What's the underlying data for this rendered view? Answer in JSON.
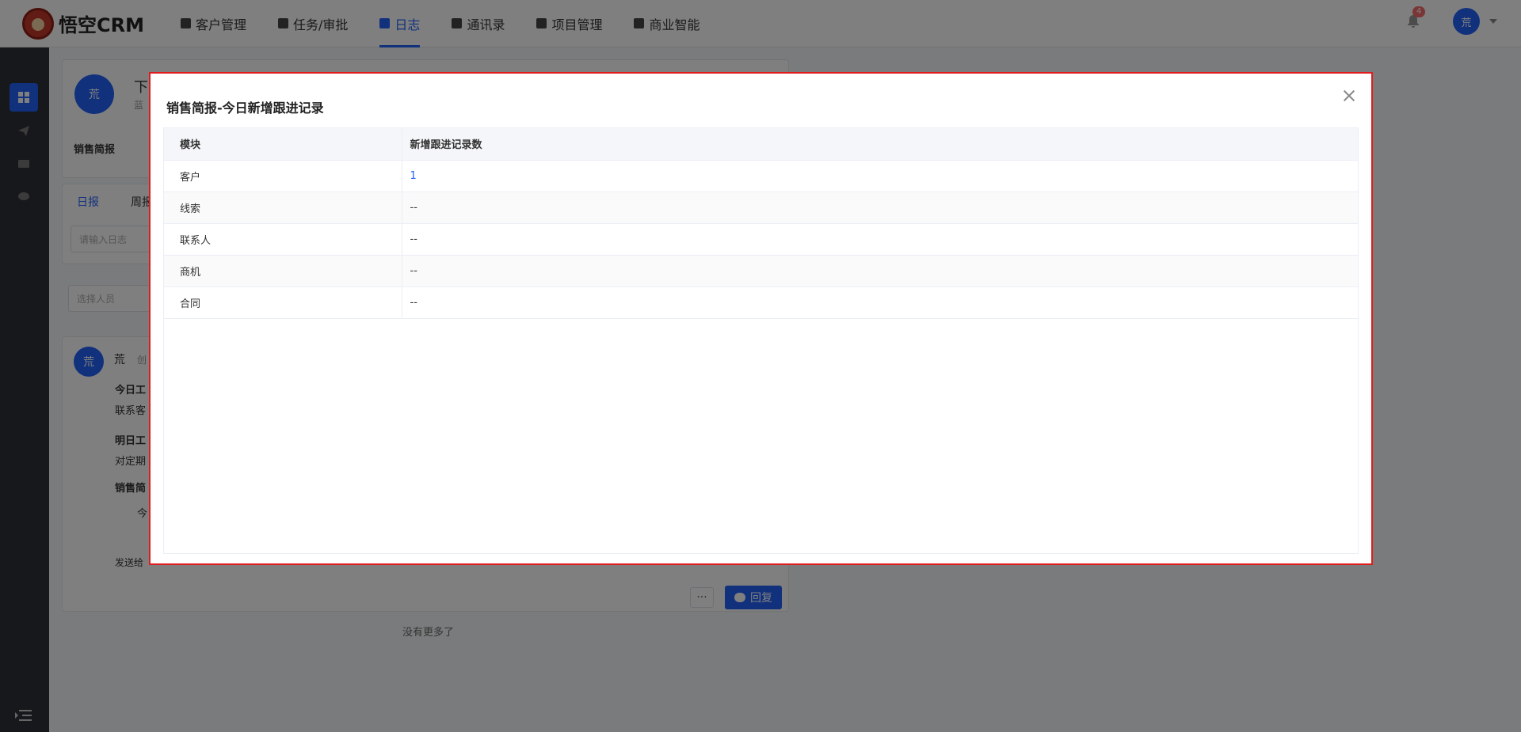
{
  "app": {
    "logo_text": "悟空CRM"
  },
  "nav": [
    {
      "label": "客户管理",
      "active": false
    },
    {
      "label": "任务/审批",
      "active": false
    },
    {
      "label": "日志",
      "active": true
    },
    {
      "label": "通讯录",
      "active": false
    },
    {
      "label": "项目管理",
      "active": false
    },
    {
      "label": "商业智能",
      "active": false
    }
  ],
  "user": {
    "avatar_text": "荒",
    "notifications": "4"
  },
  "background": {
    "avatar_text": "荒",
    "header_title": "下",
    "header_sub": "蓝",
    "sales_brief_label": "销售简报",
    "tabs": [
      "日报",
      "周报"
    ],
    "log_input_placeholder": "请输入日志",
    "select_person_placeholder": "选择人员",
    "entry_author": "荒",
    "entry_meta": "创",
    "today_work_label": "今日工",
    "today_work_text": "联系客",
    "tomorrow_work_label": "明日工",
    "tomorrow_work_text": "对定期",
    "sales_brief_label2": "销售简",
    "brief_chip": "今",
    "send_to_label": "发送给",
    "more_button": "···",
    "reply_button": "回复",
    "no_more": "没有更多了"
  },
  "dialog": {
    "title": "销售简报-今日新增跟进记录",
    "columns": [
      "模块",
      "新增跟进记录数"
    ],
    "rows": [
      {
        "module": "客户",
        "count": "1",
        "link": true
      },
      {
        "module": "线索",
        "count": "--",
        "link": false
      },
      {
        "module": "联系人",
        "count": "--",
        "link": false
      },
      {
        "module": "商机",
        "count": "--",
        "link": false
      },
      {
        "module": "合同",
        "count": "--",
        "link": false
      }
    ]
  },
  "colors": {
    "accent": "#2362fb",
    "highlight_border": "#e01c1c",
    "sidebar": "#2d3037"
  }
}
